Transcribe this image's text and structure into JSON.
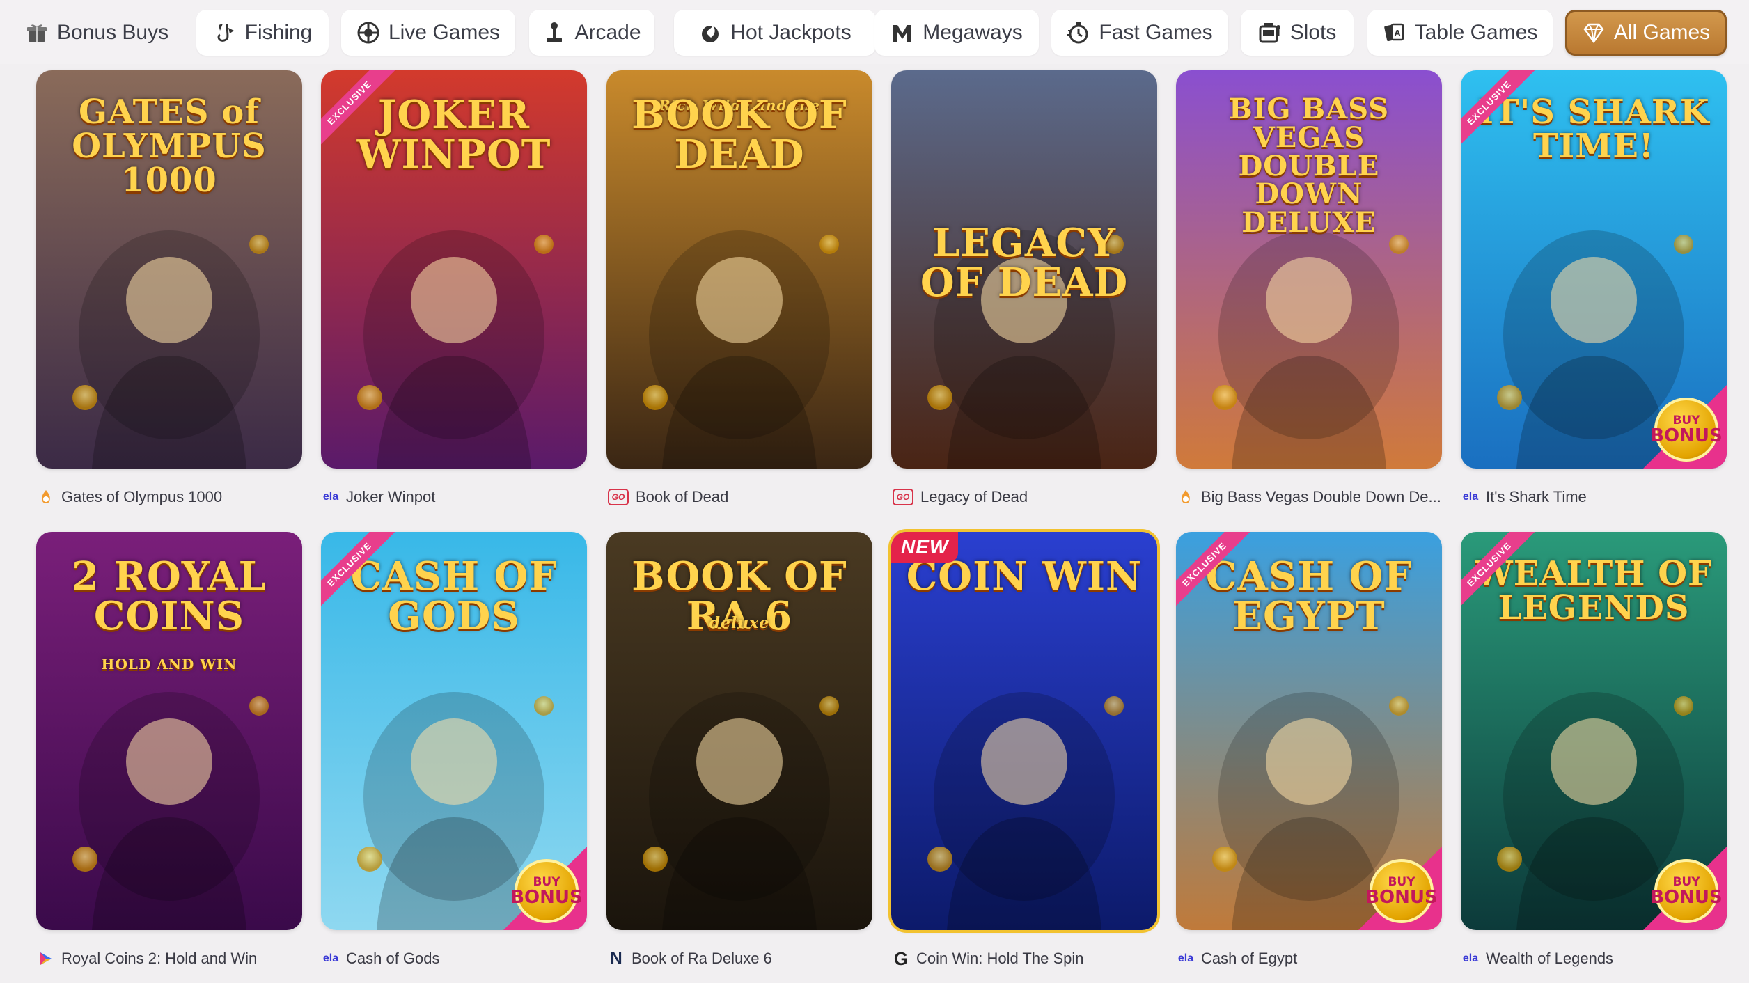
{
  "categories": [
    {
      "label": "Bonus Buys",
      "icon": "gift-icon",
      "active": false
    },
    {
      "label": "Fishing",
      "icon": "fish-hook-icon",
      "active": false
    },
    {
      "label": "Live Games",
      "icon": "roulette-icon",
      "active": false
    },
    {
      "label": "Arcade",
      "icon": "joystick-icon",
      "active": false
    },
    {
      "label": "Hot Jackpots",
      "icon": "flame-coin-icon",
      "active": false
    },
    {
      "label": "Megaways",
      "icon": "m-logo-icon",
      "active": false
    },
    {
      "label": "Fast Games",
      "icon": "stopwatch-icon",
      "active": false
    },
    {
      "label": "Slots",
      "icon": "slot-machine-icon",
      "active": false
    },
    {
      "label": "Table Games",
      "icon": "playing-cards-icon",
      "active": false
    },
    {
      "label": "All Games",
      "icon": "diamond-icon",
      "active": true
    }
  ],
  "games": [
    {
      "name": "Gates of Olympus 1000",
      "art_title": "GATES of OLYMPUS 1000",
      "provider": "pragmatic-play-icon",
      "badge": "",
      "buy_bonus": false,
      "bg": [
        "#8a6b5a",
        "#3b2a46"
      ]
    },
    {
      "name": "Joker Winpot",
      "art_title": "JOKER WINPOT",
      "provider": "ela-logo-icon",
      "provider_text": "ela",
      "badge": "EXCLUSIVE",
      "buy_bonus": false,
      "bg": [
        "#d33a2c",
        "#5a1a6a"
      ]
    },
    {
      "name": "Book of Dead",
      "art_title": "BOOK OF DEAD",
      "art_subtitle": "Rich Wilde and the",
      "provider": "play-n-go-icon",
      "provider_text": "GO",
      "badge": "",
      "buy_bonus": false,
      "bg": [
        "#c98a2c",
        "#3a2614"
      ]
    },
    {
      "name": "Legacy of Dead",
      "art_title": "LEGACY OF DEAD",
      "provider": "play-n-go-icon",
      "provider_text": "GO",
      "badge": "",
      "buy_bonus": false,
      "bg": [
        "#5b6a8c",
        "#4a2414"
      ]
    },
    {
      "name": "Big Bass Vegas Double Down De...",
      "art_title": "BIG BASS VEGAS DOUBLE DOWN DELUXE",
      "provider": "pragmatic-play-icon",
      "badge": "",
      "buy_bonus": false,
      "bg": [
        "#8a4fd0",
        "#d07a3a"
      ]
    },
    {
      "name": "It's Shark Time",
      "art_title": "IT'S SHARK TIME!",
      "provider": "ela-logo-icon",
      "provider_text": "ela",
      "badge": "EXCLUSIVE",
      "buy_bonus": true,
      "bg": [
        "#2fc0f0",
        "#1a6fc0"
      ]
    },
    {
      "name": "Royal Coins 2: Hold and Win",
      "art_title": "2 ROYAL COINS",
      "art_subtitle": "HOLD AND WIN",
      "provider": "playson-icon",
      "badge": "",
      "buy_bonus": false,
      "bg": [
        "#7a1f7a",
        "#3a0a4a"
      ]
    },
    {
      "name": "Cash of Gods",
      "art_title": "CASH OF GODS",
      "provider": "ela-logo-icon",
      "provider_text": "ela",
      "badge": "EXCLUSIVE",
      "buy_bonus": true,
      "bg": [
        "#38b8e8",
        "#8fd8f0"
      ]
    },
    {
      "name": "Book of Ra Deluxe 6",
      "art_title": "BOOK OF RA 6",
      "art_subtitle": "deluxe",
      "provider": "novomatic-icon",
      "provider_text": "N",
      "badge": "",
      "buy_bonus": false,
      "bg": [
        "#4a3a22",
        "#1a140c"
      ]
    },
    {
      "name": "Coin Win: Hold The Spin",
      "art_title": "COIN WIN",
      "provider": "gamomat-icon",
      "provider_text": "G",
      "badge": "NEW",
      "buy_bonus": false,
      "bg": [
        "#2a3fd0",
        "#0c1a6a"
      ]
    },
    {
      "name": "Cash of Egypt",
      "art_title": "CASH OF EGYPT",
      "provider": "ela-logo-icon",
      "provider_text": "ela",
      "badge": "EXCLUSIVE",
      "buy_bonus": true,
      "bg": [
        "#3aa0e0",
        "#c07a3a"
      ]
    },
    {
      "name": "Wealth of Legends",
      "art_title": "WEALTH OF LEGENDS",
      "provider": "ela-logo-icon",
      "provider_text": "ela",
      "badge": "EXCLUSIVE",
      "buy_bonus": true,
      "bg": [
        "#2a9a7a",
        "#0c3a3a"
      ]
    }
  ],
  "buy_bonus_label": [
    "BUY",
    "BONUS"
  ],
  "colors": {
    "accent": "#c98a3c",
    "badge_pink": "#e83e8c",
    "new_red": "#e4234a",
    "title_gold": "#ffd34d"
  }
}
